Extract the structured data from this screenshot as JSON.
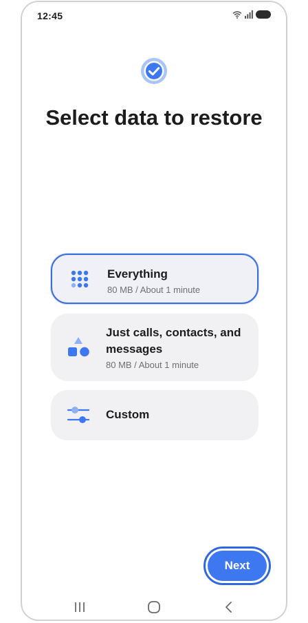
{
  "status_bar": {
    "time": "12:45",
    "icons": [
      "wifi-icon",
      "signal-icon",
      "battery-icon"
    ]
  },
  "header": {
    "icon": "check-circle-icon",
    "title": "Select data to restore"
  },
  "options": [
    {
      "icon": "grid-dots-icon",
      "title": "Everything",
      "subtitle": "80 MB / About 1 minute",
      "selected": true
    },
    {
      "icon": "shapes-icon",
      "title": "Just calls, contacts, and messages",
      "subtitle": "80 MB / About 1 minute",
      "selected": false
    },
    {
      "icon": "sliders-icon",
      "title": "Custom",
      "subtitle": "",
      "selected": false
    }
  ],
  "footer": {
    "next_label": "Next"
  },
  "nav_bar": {
    "icons": [
      "recents-icon",
      "home-icon",
      "back-icon"
    ]
  },
  "colors": {
    "accent": "#3d78f0",
    "accent_border": "#2f67df",
    "card_bg": "#f1f1f3",
    "title_text": "#1c1c1c",
    "subtitle_text": "#6f6f72"
  }
}
